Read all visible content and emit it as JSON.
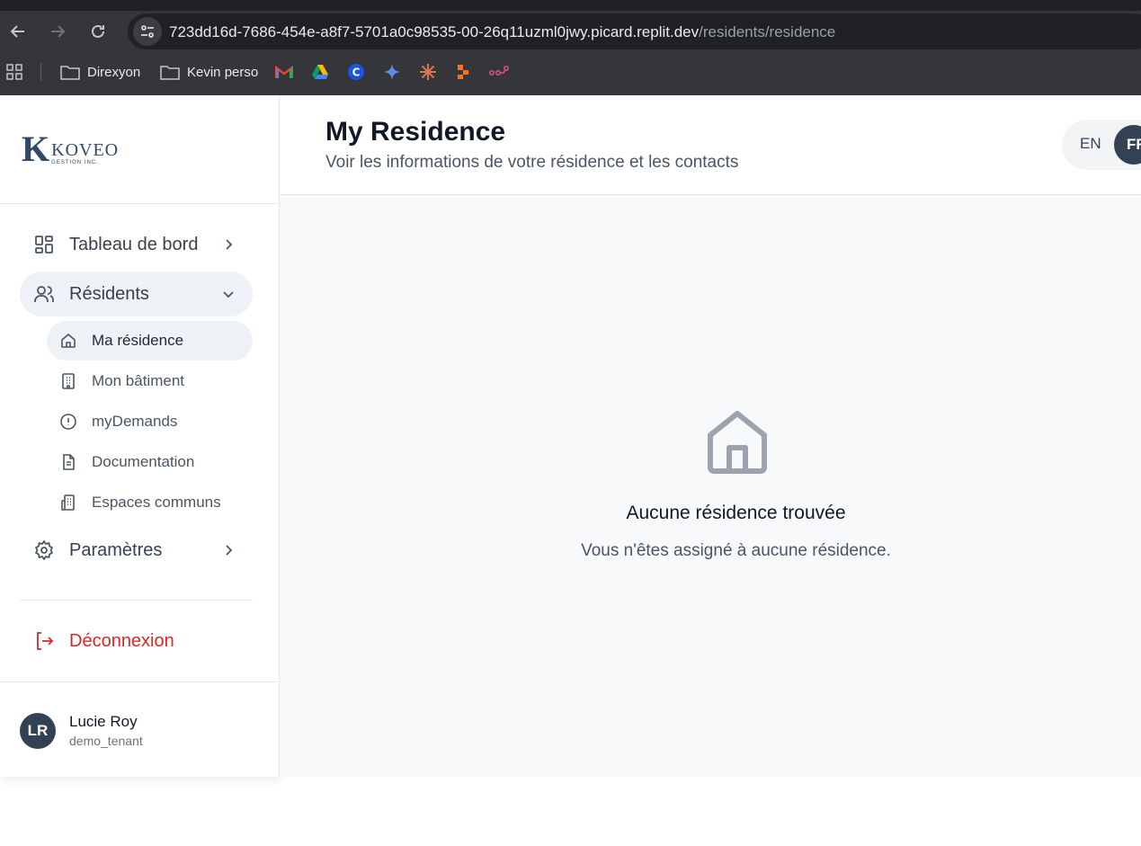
{
  "browser": {
    "url_host": "723dd16d-7686-454e-a8f7-5701a0c98535-00-26q11uzml0jwy.picard.replit.dev",
    "url_path": "/residents/residence",
    "bookmarks": [
      {
        "label": "Direxyon",
        "icon": "folder-icon"
      },
      {
        "label": "Kevin perso",
        "icon": "folder-icon"
      }
    ],
    "bookmark_icons": [
      "gmail-icon",
      "google-drive-icon",
      "c-app-icon",
      "gemini-icon",
      "claude-icon",
      "figma-like-icon",
      "flow-icon"
    ]
  },
  "logo": {
    "letter": "K",
    "name": "KOVEO",
    "sub": "GESTION INC."
  },
  "sidebar": {
    "items": [
      {
        "label": "Tableau de bord",
        "icon": "dashboard-icon"
      },
      {
        "label": "Résidents",
        "icon": "users-icon",
        "expanded": true
      },
      {
        "label": "Paramètres",
        "icon": "gear-icon"
      }
    ],
    "sub_items": [
      {
        "label": "Ma résidence",
        "icon": "home-icon",
        "active": true
      },
      {
        "label": "Mon bâtiment",
        "icon": "building-icon"
      },
      {
        "label": "myDemands",
        "icon": "alert-circle-icon"
      },
      {
        "label": "Documentation",
        "icon": "file-text-icon"
      },
      {
        "label": "Espaces communs",
        "icon": "buildings-icon"
      }
    ],
    "logout_label": "Déconnexion"
  },
  "user": {
    "initials": "LR",
    "name": "Lucie Roy",
    "role": "demo_tenant"
  },
  "header": {
    "title": "My Residence",
    "subtitle": "Voir les informations de votre résidence et les contacts",
    "lang_en": "EN",
    "lang_fr": "FR"
  },
  "empty_state": {
    "icon": "home-icon",
    "title": "Aucune résidence trouvée",
    "description": "Vous n'êtes assigné à aucune résidence."
  },
  "colors": {
    "accent": "#334155",
    "danger": "#dc2626",
    "active_bg": "#eef1f5"
  }
}
